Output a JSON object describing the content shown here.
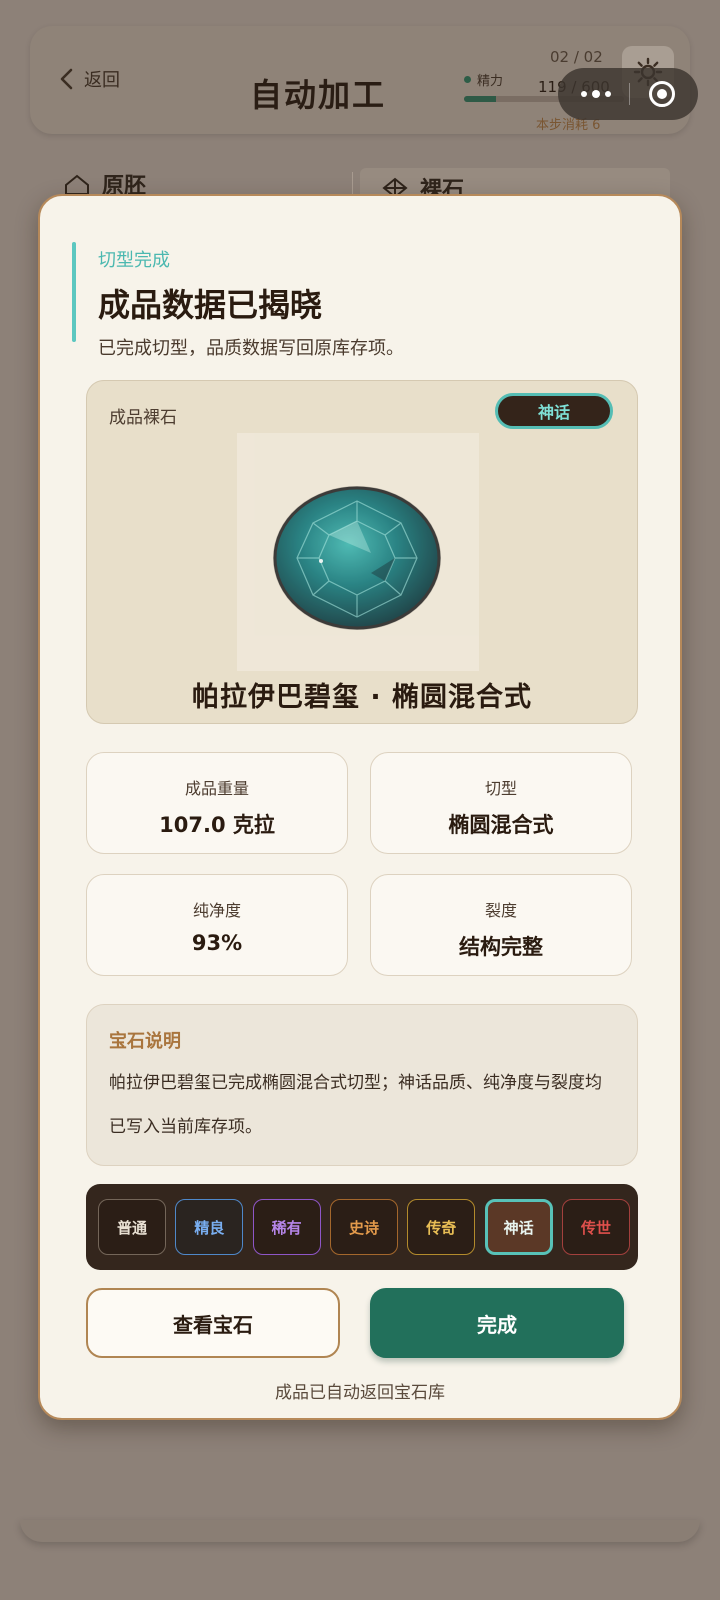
{
  "header": {
    "back_label": "返回",
    "title": "自动加工",
    "page_indicator": "02 / 02",
    "energy_label": "精力",
    "energy_value": "119 / 600",
    "energy_fraction": 0.198,
    "step_cost": "本步消耗 6"
  },
  "background_tabs": [
    {
      "label": "原胚"
    },
    {
      "label": "裸石"
    }
  ],
  "modal": {
    "eyebrow": "切型完成",
    "title": "成品数据已揭晓",
    "subtitle": "已完成切型，品质数据写回原库存项。",
    "gem_card_label": "成品裸石",
    "rarity_badge": "神话",
    "gem_name": "帕拉伊巴碧玺 · 椭圆混合式",
    "stats": [
      {
        "label": "成品重量",
        "value": "107.0 克拉"
      },
      {
        "label": "切型",
        "value": "椭圆混合式"
      },
      {
        "label": "纯净度",
        "value": "93%"
      },
      {
        "label": "裂度",
        "value": "结构完整"
      }
    ],
    "description_title": "宝石说明",
    "description_text": "帕拉伊巴碧玺已完成椭圆混合式切型；神话品质、纯净度与裂度均已写入当前库存项。",
    "rarity_tiers": [
      "普通",
      "精良",
      "稀有",
      "史诗",
      "传奇",
      "神话",
      "传世"
    ],
    "selected_rarity": "神话",
    "view_button": "查看宝石",
    "done_button": "完成",
    "footnote": "成品已自动返回宝石库"
  },
  "colors": {
    "accent_teal": "#5cc7c0",
    "primary_button": "#22705b",
    "modal_border": "#b6895a",
    "desc_title": "#a9753d"
  },
  "icons": {
    "back": "chevron-left-icon",
    "settings": "gear-icon",
    "more": "more-dots-icon",
    "close_capsule": "target-circle-icon",
    "tab_rough": "house-outline-icon",
    "tab_stone": "gem-outline-icon"
  }
}
